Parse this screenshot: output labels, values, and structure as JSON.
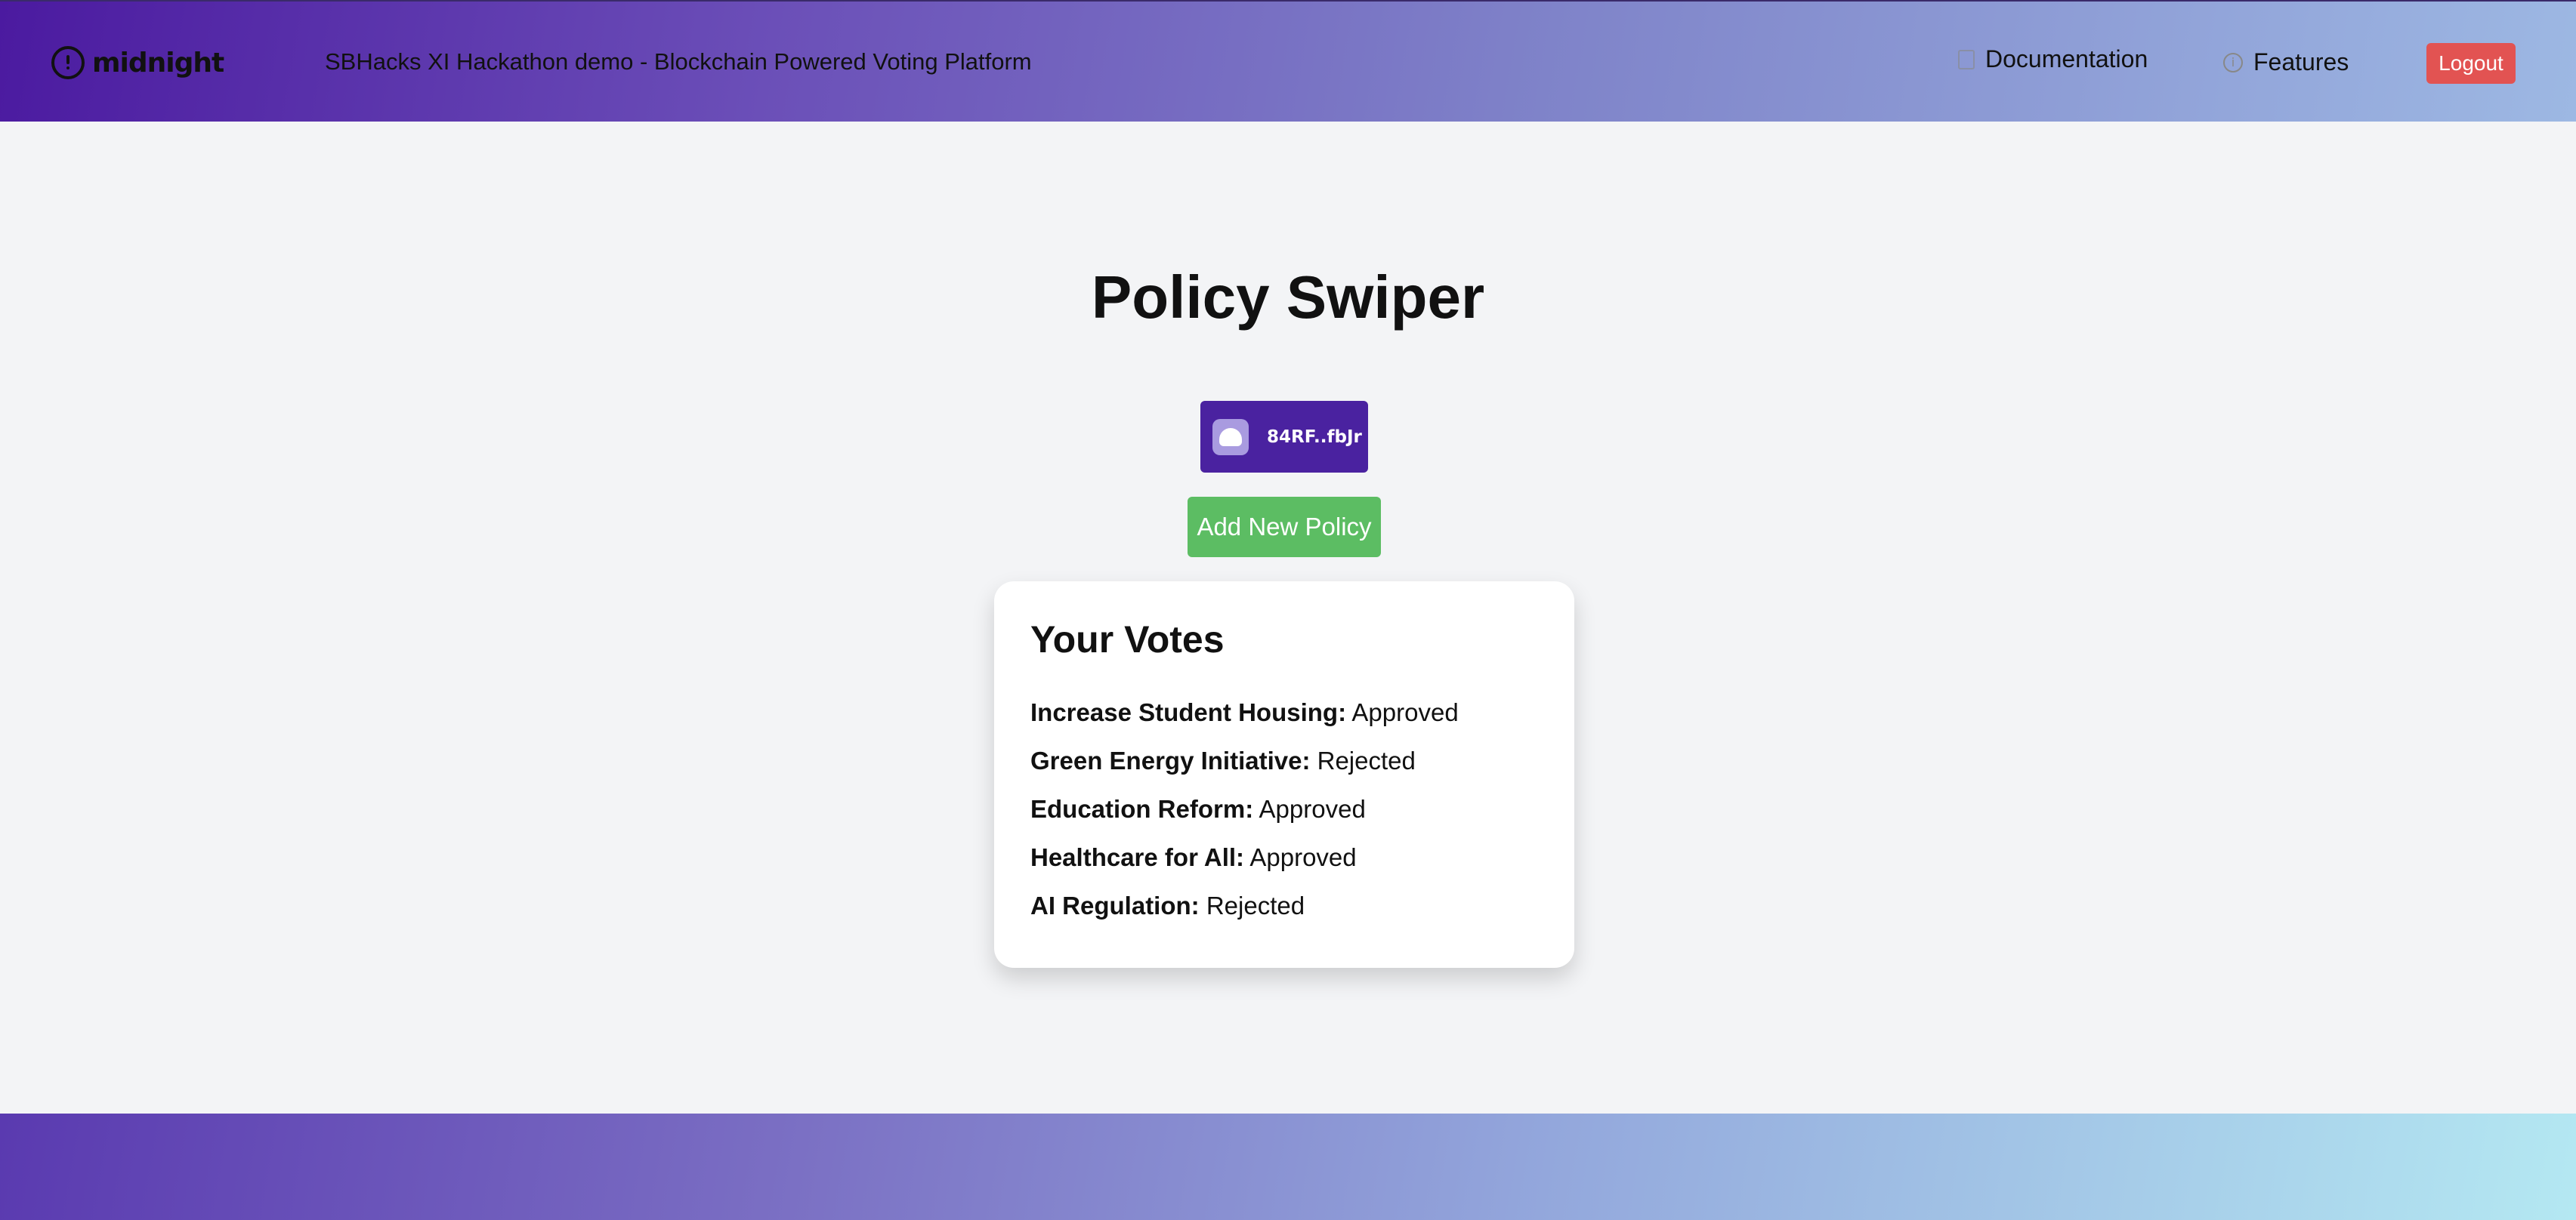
{
  "header": {
    "logo_text": "midnight",
    "app_title": "SBHacks XI Hackathon demo - Blockchain Powered Voting Platform",
    "nav": {
      "documentation_label": "Documentation",
      "documentation_icon": "document-icon",
      "features_label": "Features",
      "features_icon": "info-icon"
    },
    "logout_label": "Logout",
    "logout_color": "#e25352"
  },
  "main": {
    "title": "Policy Swiper",
    "wallet": {
      "address": "84RF..fbJr",
      "icon": "ghost-wallet-icon",
      "color": "#4a22a0"
    },
    "add_policy_label": "Add New Policy",
    "add_policy_color": "#5cbd63",
    "votes": {
      "title": "Your Votes",
      "items": [
        {
          "policy": "Increase Student Housing:",
          "decision": "Approved"
        },
        {
          "policy": "Green Energy Initiative:",
          "decision": "Rejected"
        },
        {
          "policy": "Education Reform:",
          "decision": "Approved"
        },
        {
          "policy": "Healthcare for All:",
          "decision": "Approved"
        },
        {
          "policy": "AI Regulation:",
          "decision": "Rejected"
        }
      ]
    }
  }
}
